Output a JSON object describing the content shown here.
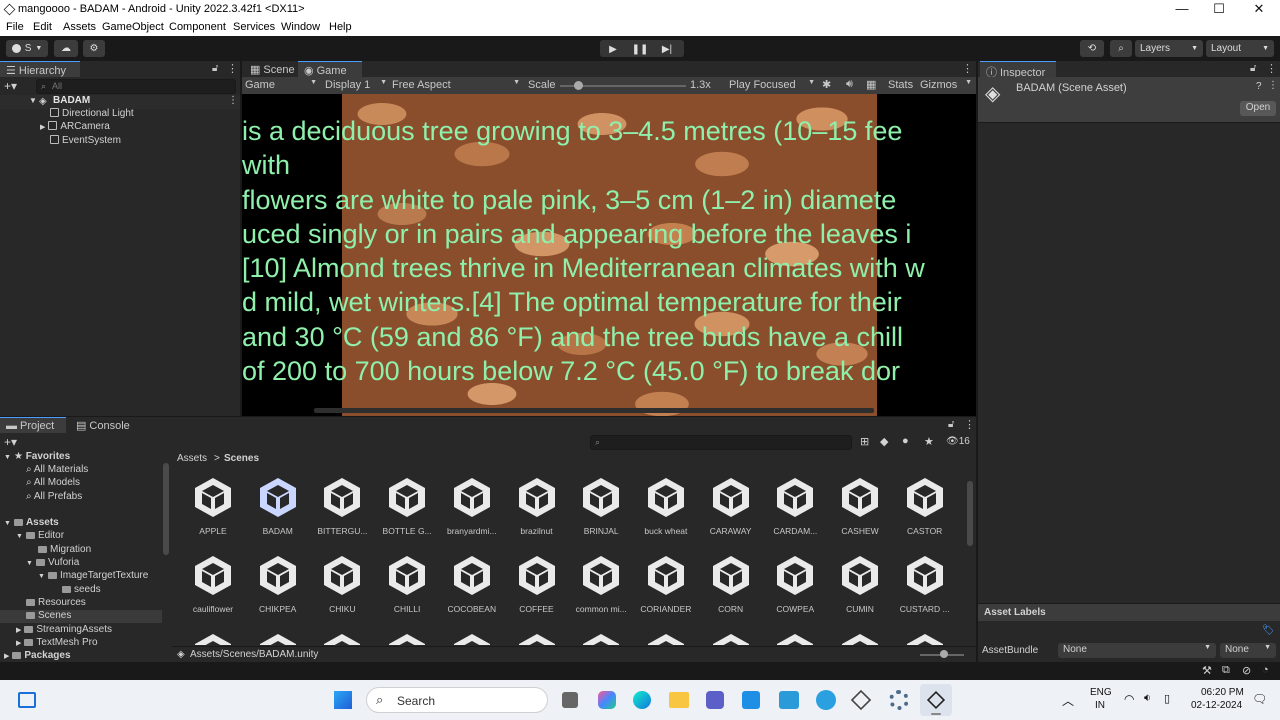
{
  "window": {
    "title": "mangoooo - BADAM - Android - Unity 2022.3.42f1 <DX11>",
    "controls": [
      "—",
      "☐",
      "✕"
    ]
  },
  "menu": [
    "File",
    "Edit",
    "Assets",
    "GameObject",
    "Component",
    "Services",
    "Window",
    "Help"
  ],
  "toolbar": {
    "account": "S",
    "layers": "Layers",
    "layout": "Layout"
  },
  "hierarchy": {
    "tab": "Hierarchy",
    "search_placeholder": "All",
    "scene": "BADAM",
    "items": [
      "Directional Light",
      "ARCamera",
      "EventSystem"
    ]
  },
  "scene_tabs": {
    "scene": "Scene",
    "game": "Game"
  },
  "game_bar": {
    "mode": "Game",
    "display": "Display 1",
    "aspect": "Free Aspect",
    "scale_label": "Scale",
    "scale_value": "1.3x",
    "play_mode": "Play Focused",
    "stats": "Stats",
    "gizmos": "Gizmos"
  },
  "game_text": [
    "is a deciduous tree growing to 3–4.5 metres (10–15 fee",
    "with",
    " flowers are white to pale pink, 3–5 cm (1–2 in) diamete",
    "uced singly or in pairs and appearing before the leaves i",
    "[10] Almond trees thrive in Mediterranean climates with w",
    "d mild, wet winters.[4] The optimal temperature for their",
    "and 30 °C (59 and 86 °F) and the tree buds have a chill",
    " of 200 to 700 hours below 7.2 °C (45.0 °F) to break dor"
  ],
  "inspector": {
    "tab": "Inspector",
    "asset_name": "BADAM (Scene Asset)",
    "open_button": "Open",
    "asset_labels": "Asset Labels",
    "asset_bundle_label": "AssetBundle",
    "asset_bundle_value": "None",
    "asset_variant_value": "None"
  },
  "project": {
    "tab_project": "Project",
    "tab_console": "Console",
    "hidden_count": "16",
    "breadcrumb_root": "Assets",
    "breadcrumb_sep": ">",
    "breadcrumb_current": "Scenes",
    "favorites": {
      "label": "Favorites",
      "items": [
        "All Materials",
        "All Models",
        "All Prefabs"
      ]
    },
    "assets_label": "Assets",
    "tree": {
      "editor": "Editor",
      "migration": "Migration",
      "vuforia": "Vuforia",
      "imagetarget": "ImageTargetTexture",
      "seeds": "seeds",
      "resources": "Resources",
      "scenes": "Scenes",
      "streaming": "StreamingAssets",
      "textmesh": "TextMesh Pro",
      "packages": "Packages"
    },
    "grid_row1": [
      "APPLE",
      "BADAM",
      "BITTERGU...",
      "BOTTLE G...",
      "branyardmi...",
      "brazilnut",
      "BRINJAL",
      "buck wheat",
      "CARAWAY",
      "CARDAM...",
      "CASHEW",
      "CASTOR"
    ],
    "grid_row2": [
      "cauliflower",
      "CHIKPEA",
      "CHIKU",
      "CHILLI",
      "COCOBEAN",
      "COFFEE",
      "common mi...",
      "CORIANDER",
      "CORN",
      "COWPEA",
      "CUMIN",
      "CUSTARD ..."
    ],
    "selected": "BADAM",
    "status_path": "Assets/Scenes/BADAM.unity"
  },
  "taskbar": {
    "search": "Search",
    "lang1": "ENG",
    "lang2": "IN",
    "time": "06:20 PM",
    "date": "02-12-2024"
  },
  "colors": {
    "accent": "#4a9eff",
    "game_text": "#8ff0ac",
    "editor_bg": "#282828"
  }
}
